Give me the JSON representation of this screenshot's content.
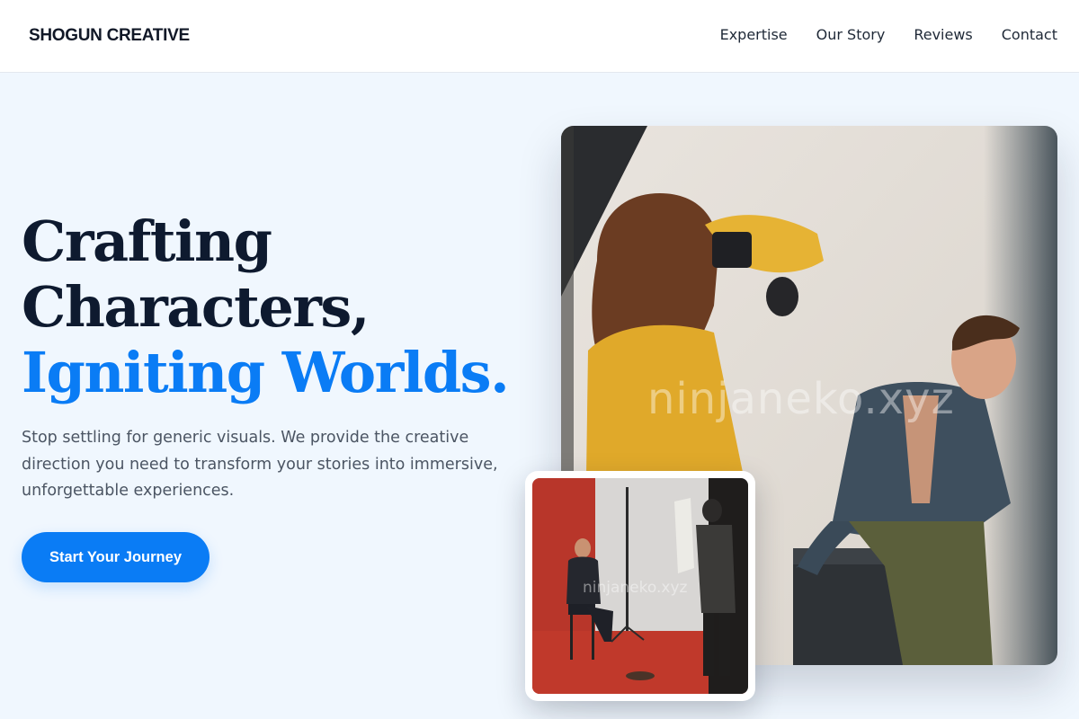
{
  "header": {
    "brand": "SHOGUN CREATIVE",
    "nav": [
      "Expertise",
      "Our Story",
      "Reviews",
      "Contact"
    ]
  },
  "hero": {
    "title_line1": "Crafting",
    "title_line2": "Characters,",
    "title_line3": "Igniting Worlds.",
    "subtitle": "Stop settling for generic visuals. We provide the creative direction you need to transform your stories into immersive, unforgettable experiences.",
    "cta_label": "Start Your Journey"
  },
  "images": {
    "main_watermark": "ninjaneko.xyz",
    "small_watermark": "ninjaneko.xyz"
  },
  "colors": {
    "accent": "#0a7cf5",
    "heading": "#0e1a2f",
    "background": "#f0f7fe",
    "body_text": "#4b5563"
  }
}
